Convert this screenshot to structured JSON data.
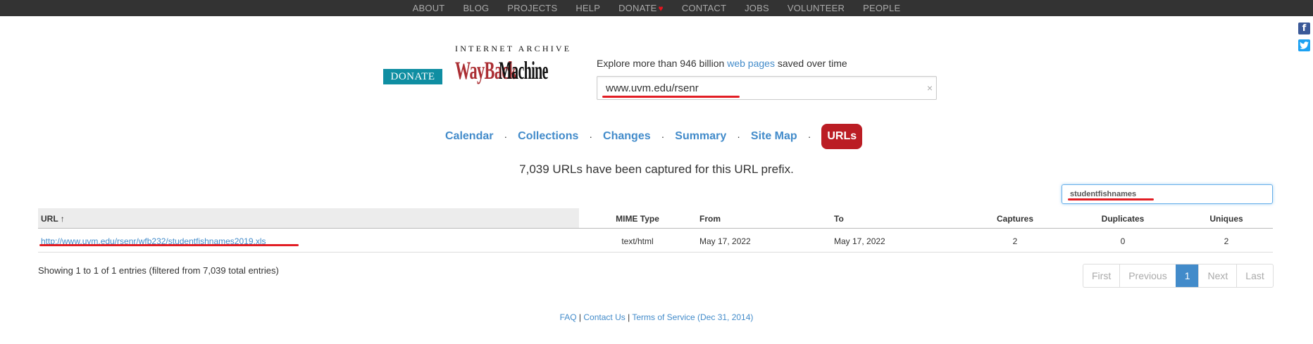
{
  "topnav": {
    "items": [
      "ABOUT",
      "BLOG",
      "PROJECTS",
      "HELP",
      "DONATE",
      "CONTACT",
      "JOBS",
      "VOLUNTEER",
      "PEOPLE"
    ],
    "donate_heart": "♥"
  },
  "social": {
    "facebook": "f",
    "twitter": "t"
  },
  "donate_button": "DONATE",
  "logo": {
    "top": "INTERNET ARCHIVE",
    "wayback": "WayBack",
    "machine": "Machine"
  },
  "tagline": {
    "before": "Explore more than 946 billion ",
    "link": "web pages",
    "after": " saved over time"
  },
  "search": {
    "value": "www.uvm.edu/rsenr",
    "clear": "×"
  },
  "tabs": [
    "Calendar",
    "Collections",
    "Changes",
    "Summary",
    "Site Map",
    "URLs"
  ],
  "tab_separator": "·",
  "capture_text": "7,039 URLs have been captured for this URL prefix.",
  "filter": {
    "value": "studentfishnames"
  },
  "table": {
    "headers": {
      "url": "URL ↑",
      "mime": "MIME Type",
      "from": "From",
      "to": "To",
      "captures": "Captures",
      "duplicates": "Duplicates",
      "uniques": "Uniques"
    },
    "rows": [
      {
        "url": "http://www.uvm.edu/rsenr/wfb232/studentfishnames2019.xls",
        "mime": "text/html",
        "from": "May 17, 2022",
        "to": "May 17, 2022",
        "captures": "2",
        "duplicates": "0",
        "uniques": "2"
      }
    ]
  },
  "showing": "Showing 1 to 1 of 1 entries (filtered from 7,039 total entries)",
  "pager": [
    "First",
    "Previous",
    "1",
    "Next",
    "Last"
  ],
  "footer": {
    "faq": "FAQ",
    "sep": " | ",
    "contact": "Contact Us",
    "terms": "Terms of Service (Dec 31, 2014)"
  },
  "colors": {
    "accent": "#428bca",
    "active_tab": "#bb1d24",
    "donate": "#0f8ea2",
    "annotation": "#e21d24"
  }
}
